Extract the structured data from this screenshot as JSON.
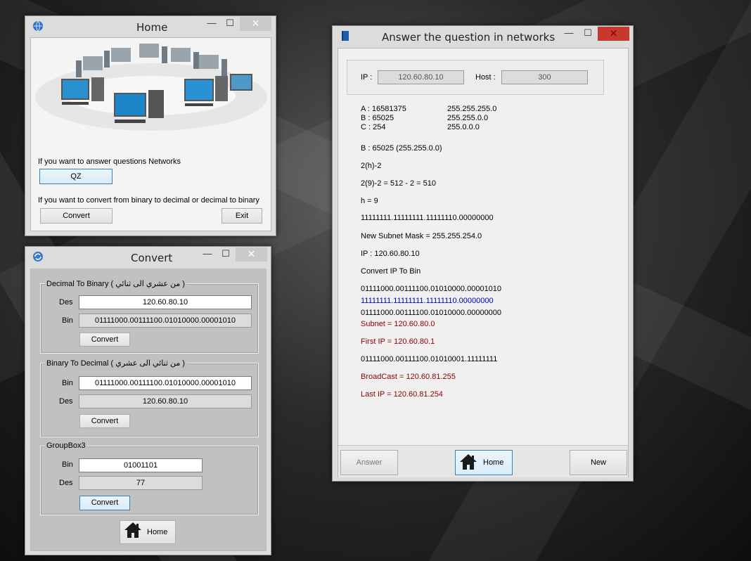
{
  "home_window": {
    "title": "Home",
    "prompt_questions": "If you want to answer questions Networks",
    "qz_button": "QZ",
    "prompt_convert": "If you want to convert from binary to decimal or decimal to binary",
    "convert_button": "Convert",
    "exit_button": "Exit"
  },
  "convert_window": {
    "title": "Convert",
    "groups": [
      {
        "legend": "Decimal To Binary ( من عشري الى ثنائي )",
        "row1_label": "Des",
        "row1_value": "120.60.80.10",
        "row2_label": "Bin",
        "row2_value": "01111000.00111100.01010000.00001010",
        "button": "Convert"
      },
      {
        "legend": "Binary To Decimal  ( من ثنائي الى عشري )",
        "row1_label": "Bin",
        "row1_value": "01111000.00111100.01010000.00001010",
        "row2_label": "Des",
        "row2_value": "120.60.80.10",
        "button": "Convert"
      },
      {
        "legend": "GroupBox3",
        "row1_label": "Bin",
        "row1_value": "01001101",
        "row2_label": "Des",
        "row2_value": "77",
        "button": "Convert"
      }
    ],
    "home_button": "Home"
  },
  "network_window": {
    "title": "Answer the question in networks",
    "ip_label": "IP :",
    "ip_value": "120.60.80.10",
    "host_label": "Host :",
    "host_value": "300",
    "classes": [
      {
        "name": "A : 16581375",
        "mask": "255.255.255.0"
      },
      {
        "name": "B : 65025",
        "mask": "255.255.0.0"
      },
      {
        "name": "C : 254",
        "mask": "255.0.0.0"
      }
    ],
    "steps": [
      {
        "text": "B : 65025  (255.255.0.0)",
        "color": "black"
      },
      {
        "text": "2(h)-2",
        "color": "black"
      },
      {
        "text": "2(9)-2 = 512 - 2 = 510",
        "color": "black"
      },
      {
        "text": "h = 9",
        "color": "black"
      },
      {
        "text": "11111111.11111111.11111110.00000000",
        "color": "black"
      },
      {
        "text": "New Subnet Mask = 255.255.254.0",
        "color": "black"
      },
      {
        "text": "IP : 120.60.80.10",
        "color": "black"
      },
      {
        "text": "Convert IP To Bin",
        "color": "black"
      },
      {
        "text": "01111000.00111100.01010000.00001010",
        "color": "black"
      },
      {
        "text": "11111111.11111111.11111110.00000000",
        "color": "blue"
      },
      {
        "text": "01111000.00111100.01010000.00000000",
        "color": "black"
      },
      {
        "text": "Subnet = 120.60.80.0",
        "color": "red"
      },
      {
        "text": "First IP = 120.60.80.1",
        "color": "red"
      },
      {
        "text": "01111000.00111100.01010001.11111111",
        "color": "black"
      },
      {
        "text": "BroadCast = 120.60.81.255",
        "color": "red"
      },
      {
        "text": "Last IP = 120.60.81.254",
        "color": "red"
      }
    ],
    "answer_button": "Answer",
    "home_button": "Home",
    "new_button": "New"
  },
  "window_controls": {
    "minimize": "—",
    "maximize": "☐",
    "close": "✕"
  },
  "colors": {
    "close_active": "#c7382d",
    "blue_text": "#0000c0",
    "red_text": "#8b0000",
    "focus_border": "#3c7fb1"
  }
}
